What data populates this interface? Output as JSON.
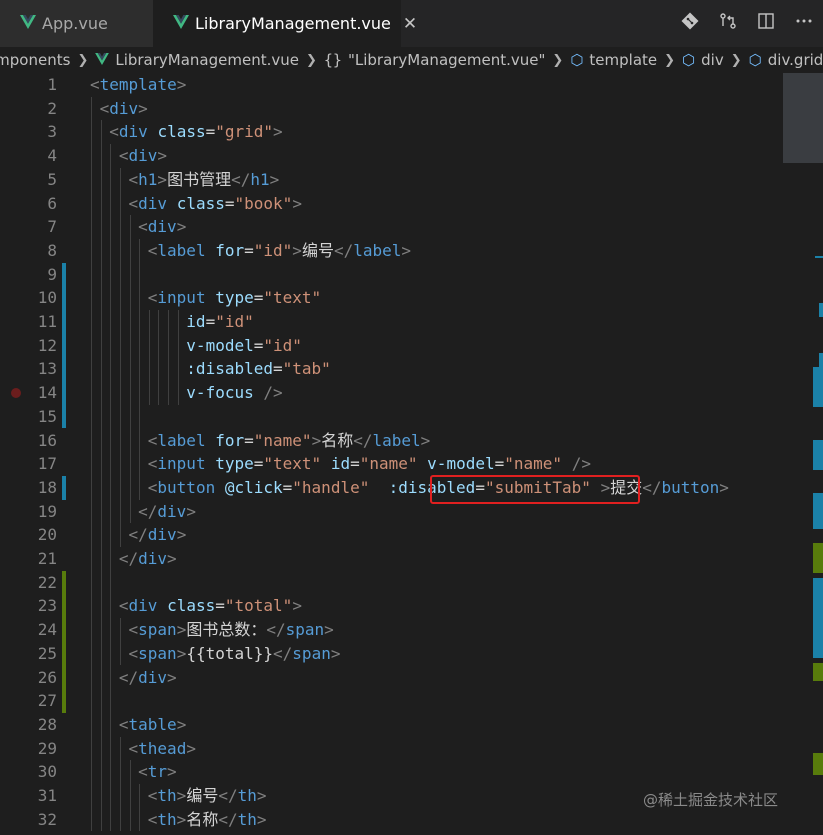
{
  "tabs": [
    {
      "label": "App.vue",
      "active": false
    },
    {
      "label": "LibraryManagement.vue",
      "active": true,
      "close": "✕"
    }
  ],
  "breadcrumb": [
    "omponents",
    "LibraryManagement.vue",
    "\"LibraryManagement.vue\"",
    "template",
    "div",
    "div.grid"
  ],
  "code_lines": [
    [
      [
        "punc",
        "<"
      ],
      [
        "tag",
        "template"
      ],
      [
        "punc",
        ">"
      ]
    ],
    [
      [
        "punc",
        "<"
      ],
      [
        "tag",
        "div"
      ],
      [
        "punc",
        ">"
      ]
    ],
    [
      [
        "punc",
        "<"
      ],
      [
        "tag",
        "div"
      ],
      [
        "text",
        " "
      ],
      [
        "attr",
        "class"
      ],
      [
        "text",
        "="
      ],
      [
        "str",
        "\"grid\""
      ],
      [
        "punc",
        ">"
      ]
    ],
    [
      [
        "punc",
        "<"
      ],
      [
        "tag",
        "div"
      ],
      [
        "punc",
        ">"
      ]
    ],
    [
      [
        "punc",
        "<"
      ],
      [
        "tag",
        "h1"
      ],
      [
        "punc",
        ">"
      ],
      [
        "text",
        "图书管理"
      ],
      [
        "punc",
        "</"
      ],
      [
        "tag",
        "h1"
      ],
      [
        "punc",
        ">"
      ]
    ],
    [
      [
        "punc",
        "<"
      ],
      [
        "tag",
        "div"
      ],
      [
        "text",
        " "
      ],
      [
        "attr",
        "class"
      ],
      [
        "text",
        "="
      ],
      [
        "str",
        "\"book\""
      ],
      [
        "punc",
        ">"
      ]
    ],
    [
      [
        "punc",
        "<"
      ],
      [
        "tag",
        "div"
      ],
      [
        "punc",
        ">"
      ]
    ],
    [
      [
        "punc",
        "<"
      ],
      [
        "tag",
        "label"
      ],
      [
        "text",
        " "
      ],
      [
        "attr",
        "for"
      ],
      [
        "text",
        "="
      ],
      [
        "str",
        "\"id\""
      ],
      [
        "punc",
        ">"
      ],
      [
        "text",
        "编号"
      ],
      [
        "punc",
        "</"
      ],
      [
        "tag",
        "label"
      ],
      [
        "punc",
        ">"
      ]
    ],
    [],
    [
      [
        "punc",
        "<"
      ],
      [
        "tag",
        "input"
      ],
      [
        "text",
        " "
      ],
      [
        "attr",
        "type"
      ],
      [
        "text",
        "="
      ],
      [
        "str",
        "\"text\""
      ]
    ],
    [
      [
        "attr",
        "id"
      ],
      [
        "text",
        "="
      ],
      [
        "str",
        "\"id\""
      ]
    ],
    [
      [
        "attr",
        "v-model"
      ],
      [
        "text",
        "="
      ],
      [
        "str",
        "\"id\""
      ]
    ],
    [
      [
        "attr",
        ":disabled"
      ],
      [
        "text",
        "="
      ],
      [
        "str",
        "\"tab\""
      ]
    ],
    [
      [
        "attr",
        "v-focus"
      ],
      [
        "text",
        " "
      ],
      [
        "punc",
        "/>"
      ]
    ],
    [],
    [
      [
        "punc",
        "<"
      ],
      [
        "tag",
        "label"
      ],
      [
        "text",
        " "
      ],
      [
        "attr",
        "for"
      ],
      [
        "text",
        "="
      ],
      [
        "str",
        "\"name\""
      ],
      [
        "punc",
        ">"
      ],
      [
        "text",
        "名称"
      ],
      [
        "punc",
        "</"
      ],
      [
        "tag",
        "label"
      ],
      [
        "punc",
        ">"
      ]
    ],
    [
      [
        "punc",
        "<"
      ],
      [
        "tag",
        "input"
      ],
      [
        "text",
        " "
      ],
      [
        "attr",
        "type"
      ],
      [
        "text",
        "="
      ],
      [
        "str",
        "\"text\""
      ],
      [
        "text",
        " "
      ],
      [
        "attr",
        "id"
      ],
      [
        "text",
        "="
      ],
      [
        "str",
        "\"name\""
      ],
      [
        "text",
        " "
      ],
      [
        "attr",
        "v-model"
      ],
      [
        "text",
        "="
      ],
      [
        "str",
        "\"name\""
      ],
      [
        "text",
        " "
      ],
      [
        "punc",
        "/>"
      ]
    ],
    [
      [
        "punc",
        "<"
      ],
      [
        "tag",
        "button"
      ],
      [
        "text",
        " "
      ],
      [
        "attr",
        "@click"
      ],
      [
        "text",
        "="
      ],
      [
        "str",
        "\"handle\""
      ],
      [
        "text",
        "  "
      ],
      [
        "attr",
        ":disabled"
      ],
      [
        "text",
        "="
      ],
      [
        "str",
        "\"submitTab\""
      ],
      [
        "text",
        " "
      ],
      [
        "punc",
        ">"
      ],
      [
        "text",
        "提交"
      ],
      [
        "punc",
        "</"
      ],
      [
        "tag",
        "button"
      ],
      [
        "punc",
        ">"
      ]
    ],
    [
      [
        "punc",
        "</"
      ],
      [
        "tag",
        "div"
      ],
      [
        "punc",
        ">"
      ]
    ],
    [
      [
        "punc",
        "</"
      ],
      [
        "tag",
        "div"
      ],
      [
        "punc",
        ">"
      ]
    ],
    [
      [
        "punc",
        "</"
      ],
      [
        "tag",
        "div"
      ],
      [
        "punc",
        ">"
      ]
    ],
    [],
    [
      [
        "punc",
        "<"
      ],
      [
        "tag",
        "div"
      ],
      [
        "text",
        " "
      ],
      [
        "attr",
        "class"
      ],
      [
        "text",
        "="
      ],
      [
        "str",
        "\"total\""
      ],
      [
        "punc",
        ">"
      ]
    ],
    [
      [
        "punc",
        "<"
      ],
      [
        "tag",
        "span"
      ],
      [
        "punc",
        ">"
      ],
      [
        "text",
        "图书总数："
      ],
      [
        "punc",
        "</"
      ],
      [
        "tag",
        "span"
      ],
      [
        "punc",
        ">"
      ]
    ],
    [
      [
        "punc",
        "<"
      ],
      [
        "tag",
        "span"
      ],
      [
        "punc",
        ">"
      ],
      [
        "text",
        "{{total}}"
      ],
      [
        "punc",
        "</"
      ],
      [
        "tag",
        "span"
      ],
      [
        "punc",
        ">"
      ]
    ],
    [
      [
        "punc",
        "</"
      ],
      [
        "tag",
        "div"
      ],
      [
        "punc",
        ">"
      ]
    ],
    [],
    [
      [
        "punc",
        "<"
      ],
      [
        "tag",
        "table"
      ],
      [
        "punc",
        ">"
      ]
    ],
    [
      [
        "punc",
        "<"
      ],
      [
        "tag",
        "thead"
      ],
      [
        "punc",
        ">"
      ]
    ],
    [
      [
        "punc",
        "<"
      ],
      [
        "tag",
        "tr"
      ],
      [
        "punc",
        ">"
      ]
    ],
    [
      [
        "punc",
        "<"
      ],
      [
        "tag",
        "th"
      ],
      [
        "punc",
        ">"
      ],
      [
        "text",
        "编号"
      ],
      [
        "punc",
        "</"
      ],
      [
        "tag",
        "th"
      ],
      [
        "punc",
        ">"
      ]
    ],
    [
      [
        "punc",
        "<"
      ],
      [
        "tag",
        "th"
      ],
      [
        "punc",
        ">"
      ],
      [
        "text",
        "名称"
      ],
      [
        "punc",
        "</"
      ],
      [
        "tag",
        "th"
      ],
      [
        "punc",
        ">"
      ]
    ]
  ],
  "line_numbers": [
    "1",
    "2",
    "3",
    "4",
    "5",
    "6",
    "7",
    "8",
    "9",
    "10",
    "11",
    "12",
    "13",
    "14",
    "15",
    "16",
    "17",
    "18",
    "19",
    "20",
    "21",
    "22",
    "23",
    "24",
    "25",
    "26",
    "27",
    "28",
    "29",
    "30",
    "31",
    "32"
  ],
  "icons": {
    "vue": "vue-icon",
    "close": "close-icon",
    "git_compare": "git-compare-icon",
    "source_control": "source-control-icon",
    "split_editor": "split-editor-icon",
    "more": "more-icon",
    "cube": "symbol-cube-icon",
    "breakpoint": "breakpoint-icon"
  },
  "colors": {
    "tag": "#569cd6",
    "attribute": "#9cdcfe",
    "string": "#ce9178",
    "punctuation": "#808080",
    "text": "#d4d4d4",
    "highlight_box": "#e02020",
    "vue_green": "#41b883"
  },
  "watermark": "@稀土掘金技术社区"
}
